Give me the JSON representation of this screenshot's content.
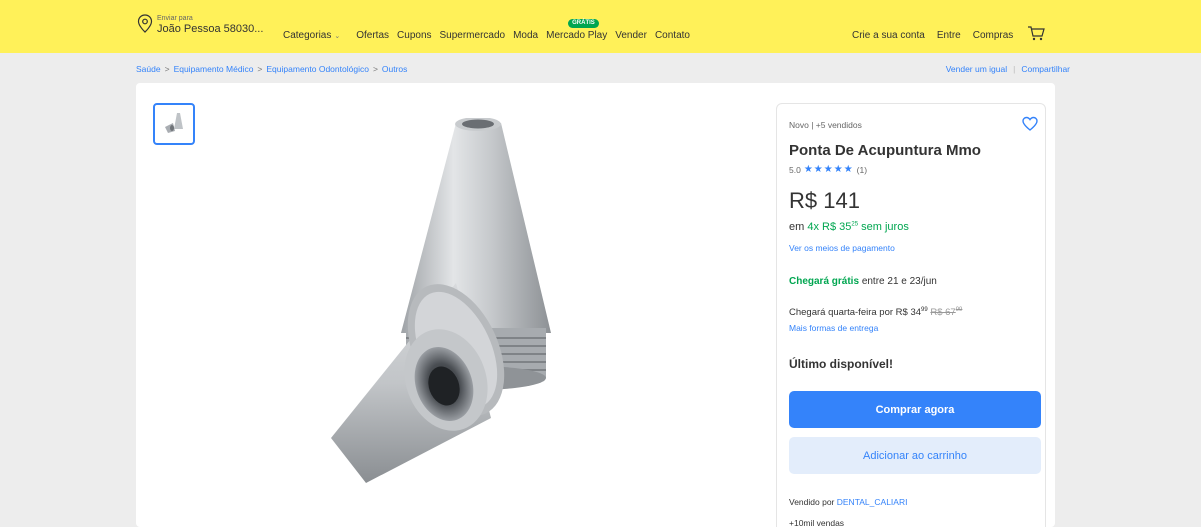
{
  "header": {
    "location_small": "Enviar para",
    "location_main": "João Pessoa 58030...",
    "nav": {
      "categorias": "Categorias",
      "ofertas": "Ofertas",
      "cupons": "Cupons",
      "supermercado": "Supermercado",
      "moda": "Moda",
      "mercado_play": "Mercado Play",
      "mercado_play_badge": "GRÁTIS",
      "vender": "Vender",
      "contato": "Contato"
    },
    "right": {
      "create_account": "Crie a sua conta",
      "login": "Entre",
      "purchases": "Compras"
    }
  },
  "breadcrumb": {
    "items": [
      "Saúde",
      "Equipamento Médico",
      "Equipamento Odontológico",
      "Outros"
    ],
    "separator": ">",
    "sell_similar": "Vender um igual",
    "share": "Compartilhar"
  },
  "product": {
    "condition": "Novo | +5 vendidos",
    "title": "Ponta De Acupuntura Mmo",
    "rating_value": "5.0",
    "rating_count": "(1)",
    "price": "R$ 141",
    "installments_prefix": "em",
    "installments_count": "4x",
    "installments_value": "R$ 35",
    "installments_cents": "25",
    "installments_suffix": "sem juros",
    "payment_link": "Ver os meios de pagamento",
    "ship_free_label": "Chegará grátis",
    "ship_free_dates": "entre 21 e 23/jun",
    "ship_fast_text": "Chegará quarta-feira por R$ 34",
    "ship_fast_cents": "99",
    "ship_old_price": "R$ 67",
    "ship_old_cents": "99",
    "more_shipping": "Mais formas de entrega",
    "stock": "Último disponível!",
    "buy_now": "Comprar agora",
    "add_to_cart": "Adicionar ao carrinho",
    "sold_by_label": "Vendido por",
    "seller": "DENTAL_CALIARI",
    "sales": "+10mil vendas"
  },
  "colors": {
    "header_bg": "#fff159",
    "accent": "#3483fa",
    "green": "#00a650"
  }
}
